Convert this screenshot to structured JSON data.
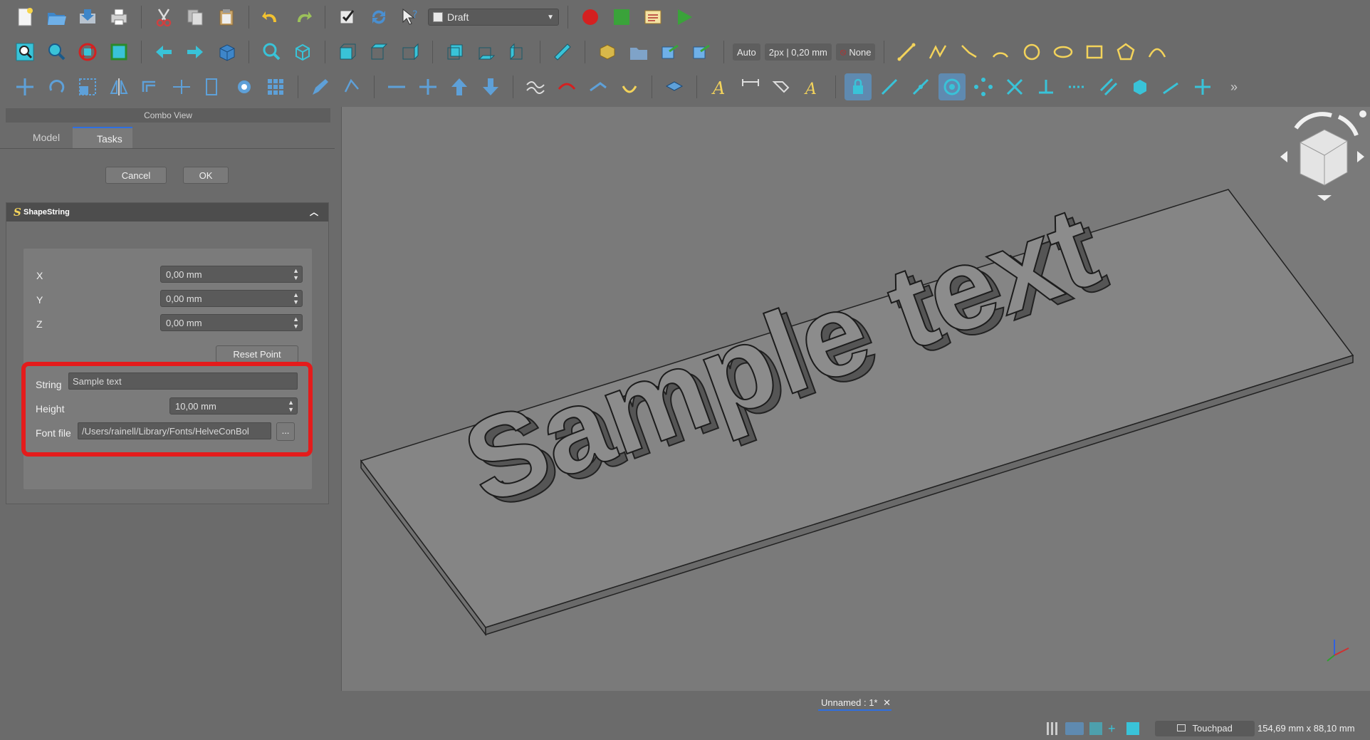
{
  "toolbar": {
    "workbench": "Draft",
    "snap_mode": "Auto",
    "line_width": "2px | 0,20 mm",
    "construction": "None"
  },
  "combo_view": {
    "title": "Combo View",
    "tabs": [
      "Model",
      "Tasks"
    ],
    "cancel_label": "Cancel",
    "ok_label": "OK"
  },
  "shapestring": {
    "panel_title": "ShapeString",
    "x_label": "X",
    "x_value": "0,00 mm",
    "y_label": "Y",
    "y_value": "0,00 mm",
    "z_label": "Z",
    "z_value": "0,00 mm",
    "reset_label": "Reset Point",
    "string_label": "String",
    "string_value": "Sample text",
    "height_label": "Height",
    "height_value": "10,00 mm",
    "font_label": "Font file",
    "font_value": "/Users/rainell/Library/Fonts/HelveConBol",
    "browse_label": "..."
  },
  "viewport": {
    "text_3d": "Sample text",
    "highlight_color": "#e41b1b"
  },
  "document_tab": "Unnamed : 1*",
  "status": {
    "navigation": "Touchpad",
    "dimensions": "154,69 mm x 88,10 mm"
  }
}
